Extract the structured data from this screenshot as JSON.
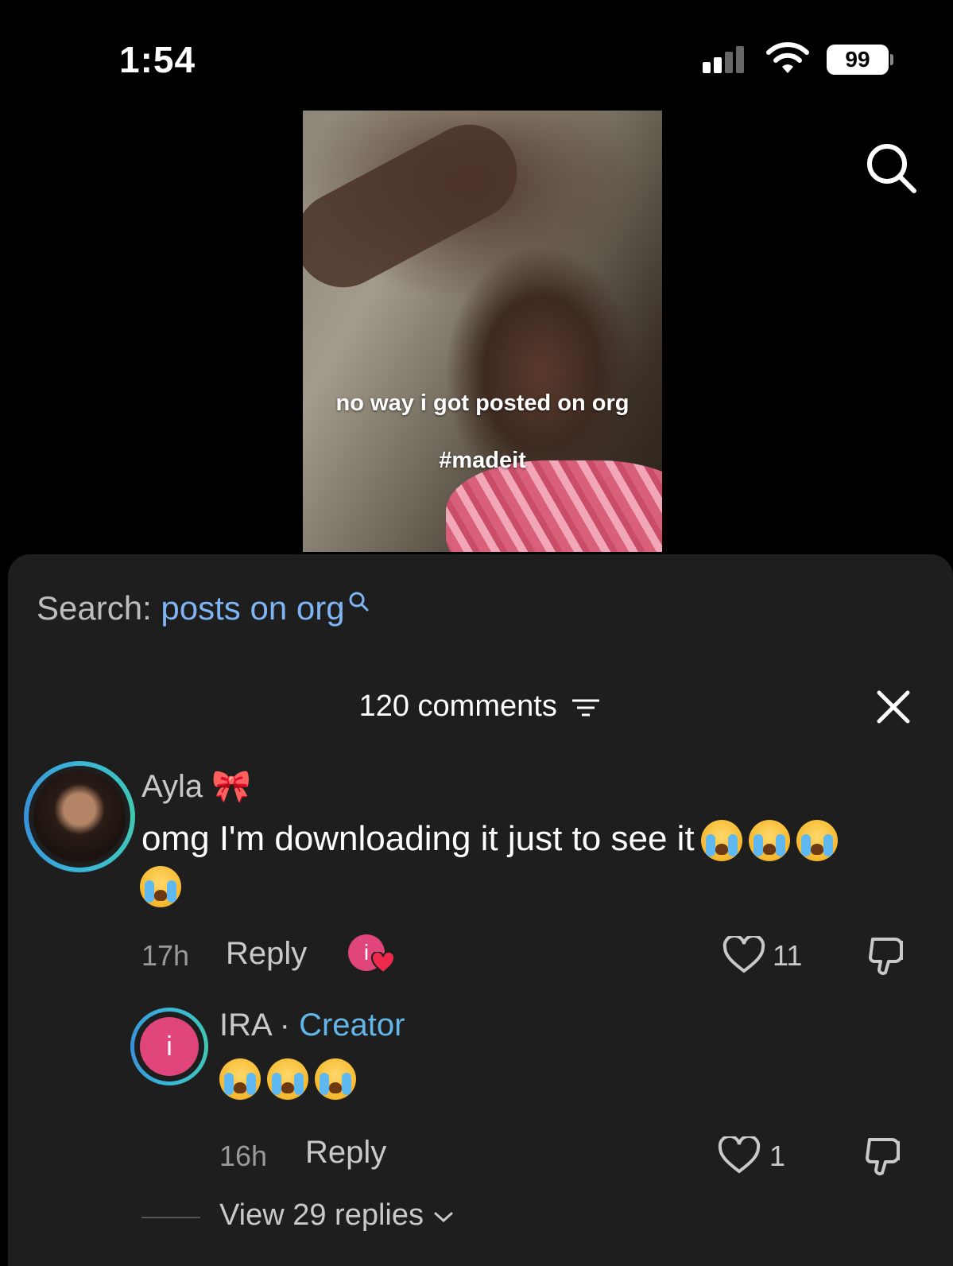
{
  "status_bar": {
    "time": "1:54",
    "battery": "99"
  },
  "video": {
    "caption_line1": "no way i got posted on org",
    "caption_line2": "#madeit"
  },
  "search": {
    "label": "Search:",
    "query": "posts on org"
  },
  "comments_header": {
    "count_label": "120 comments"
  },
  "comments": [
    {
      "username": "Ayla",
      "username_emoji": "🎀",
      "text": "omg I'm downloading it just to see it",
      "time": "17h",
      "reply_label": "Reply",
      "likes": "11",
      "creator_liked_avatar_letter": "i"
    },
    {
      "username": "IRA",
      "separator": "·",
      "role": "Creator",
      "avatar_letter": "i",
      "time": "16h",
      "reply_label": "Reply",
      "likes": "1"
    }
  ],
  "view_replies_label": "View 29 replies",
  "colors": {
    "accent_blue": "#7fb5f4",
    "creator_blue": "#62b7e8",
    "sheet_bg": "#1e1e1e",
    "avatar_pink": "#e0457b"
  }
}
